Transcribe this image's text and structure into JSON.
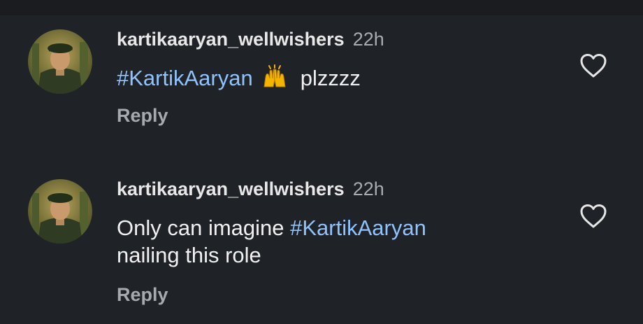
{
  "comments": [
    {
      "username": "kartikaaryan_wellwishers",
      "time": "22h",
      "hashtag": "#KartikAaryan",
      "emoji": "raising-hands",
      "text_after": "plzzzz",
      "reply_label": "Reply"
    },
    {
      "username": "kartikaaryan_wellwishers",
      "time": "22h",
      "text_before": "Only can imagine ",
      "hashtag": "#KartikAaryan",
      "line2": "nailing this role",
      "reply_label": "Reply"
    }
  ],
  "colors": {
    "background": "#1f2226",
    "hashtag": "#8fc3ff",
    "text": "#f1f1f1",
    "muted": "#a9abb0"
  }
}
